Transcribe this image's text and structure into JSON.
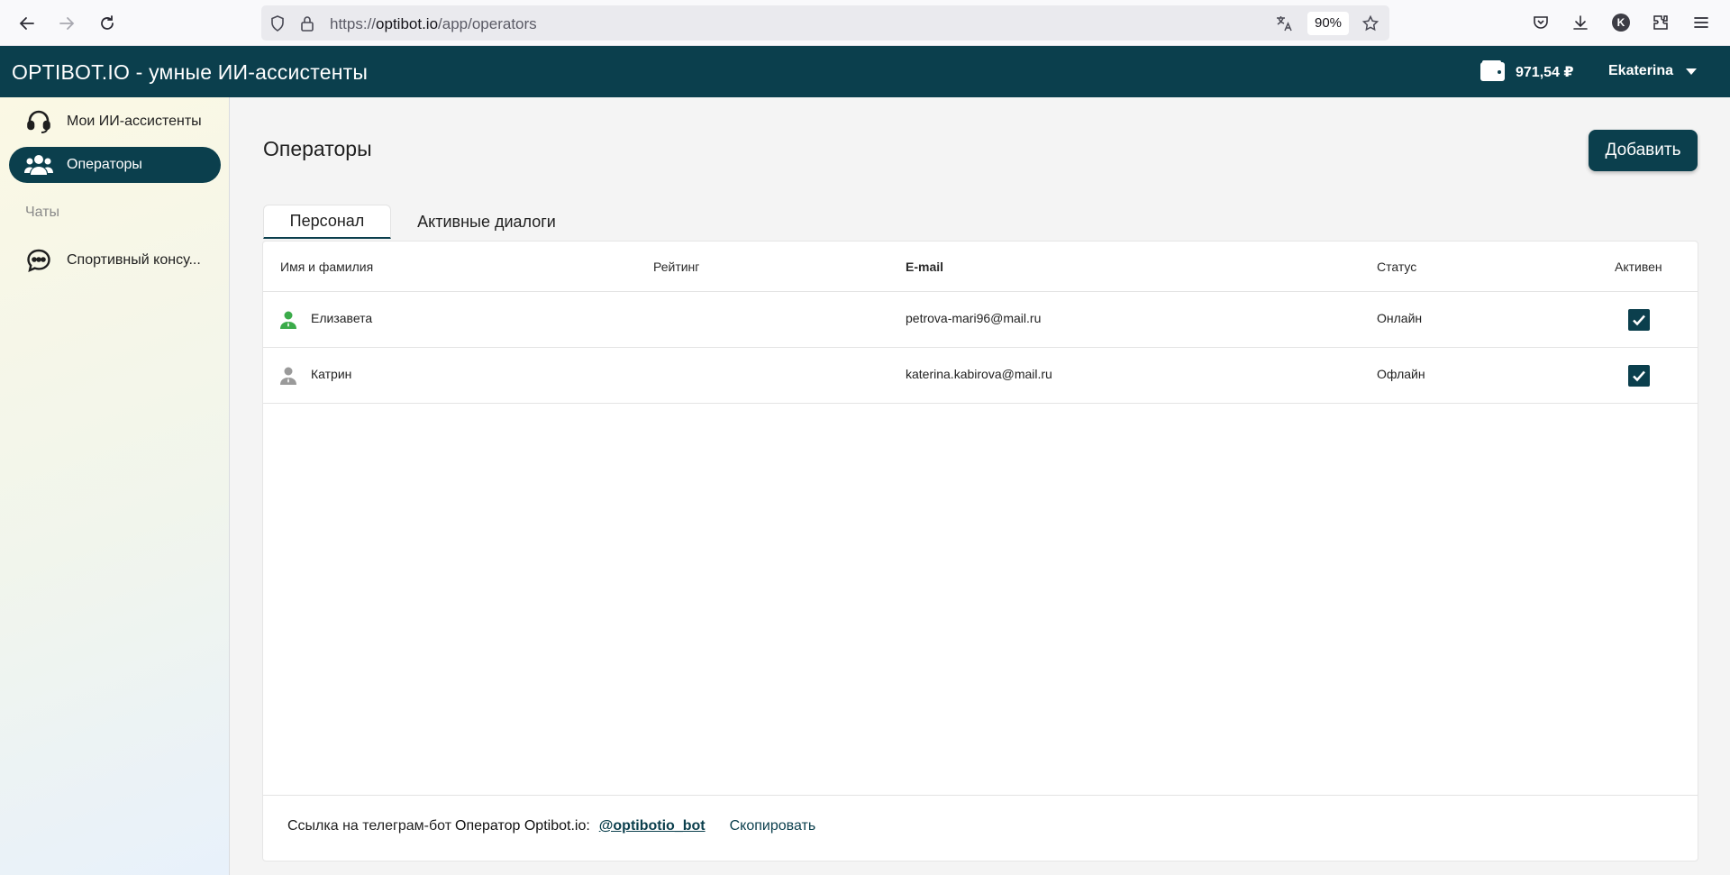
{
  "browser": {
    "url_prefix": "https://",
    "url_host": "optibot.io",
    "url_path": "/app/operators",
    "zoom": "90%",
    "profile_initial": "K"
  },
  "header": {
    "title": "OPTIBOT.IO - умные ИИ-ассистенты",
    "balance": "971,54 ₽",
    "user": "Ekaterina"
  },
  "sidebar": {
    "items": [
      {
        "label": "Мои ИИ-ассистенты",
        "icon": "headset-icon"
      },
      {
        "label": "Операторы",
        "icon": "users-icon"
      }
    ],
    "section": "Чаты",
    "chats": [
      {
        "label": "Спортивный консу...",
        "icon": "chat-bubble-icon"
      }
    ]
  },
  "main": {
    "title": "Операторы",
    "add_button": "Добавить",
    "tabs": [
      {
        "label": "Персонал",
        "active": true
      },
      {
        "label": "Активные диалоги",
        "active": false
      }
    ],
    "table": {
      "columns": [
        "Имя и фамилия",
        "Рейтинг",
        "E-mail",
        "Статус",
        "Активен"
      ],
      "rows": [
        {
          "name": "Елизавета",
          "rating": "",
          "email": "petrova-mari96@mail.ru",
          "status": "Онлайн",
          "active": true,
          "status_color": "#3bab4a"
        },
        {
          "name": "Катрин",
          "rating": "",
          "email": "katerina.kabirova@mail.ru",
          "status": "Офлайн",
          "active": true,
          "status_color": "#9a9a9a"
        }
      ]
    },
    "footer": {
      "text": "Ссылка на телеграм-бот",
      "bot_name": "Оператор Optibot.io:",
      "bot_handle": "@optibotio_bot",
      "copy": "Скопировать"
    }
  },
  "colors": {
    "brand": "#0b3f4d",
    "online": "#3bab4a",
    "offline": "#9a9a9a"
  }
}
